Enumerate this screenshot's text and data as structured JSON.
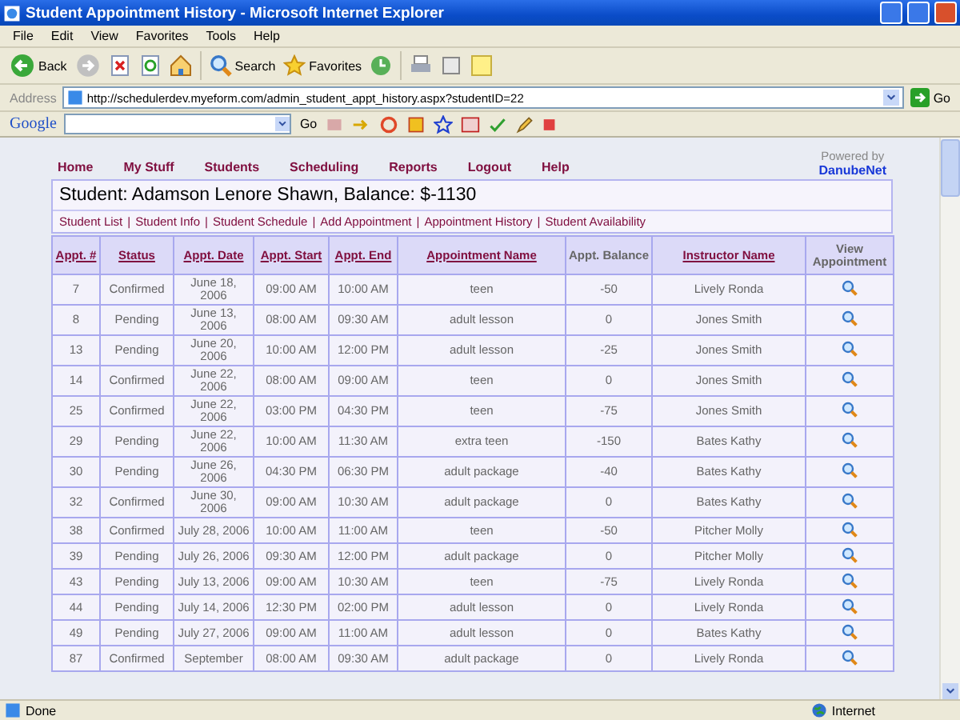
{
  "window": {
    "title": "Student Appointment History - Microsoft Internet Explorer"
  },
  "menu_bar": [
    "File",
    "Edit",
    "View",
    "Favorites",
    "Tools",
    "Help"
  ],
  "toolbar": {
    "back": "Back",
    "search": "Search",
    "favorites": "Favorites"
  },
  "address_bar": {
    "label": "Address",
    "value": "http://schedulerdev.myeform.com/admin_student_appt_history.aspx?studentID=22",
    "go": "Go"
  },
  "google_bar": {
    "logo": "Google",
    "go": "Go"
  },
  "nav": [
    "Home",
    "My Stuff",
    "Students",
    "Scheduling",
    "Reports",
    "Logout",
    "Help"
  ],
  "powered_by": {
    "label": "Powered by",
    "brand": "DanubeNet"
  },
  "heading": "Student: Adamson Lenore Shawn, Balance: $-1130",
  "link_separator": "|",
  "links": [
    "Student List",
    "Student Info",
    "Student Schedule",
    "Add Appointment",
    "Appointment History",
    "Student Availability"
  ],
  "table": {
    "columns": [
      {
        "label": "Appt. #",
        "sortable": true
      },
      {
        "label": "Status",
        "sortable": true
      },
      {
        "label": "Appt. Date",
        "sortable": true
      },
      {
        "label": "Appt. Start",
        "sortable": true
      },
      {
        "label": "Appt. End",
        "sortable": true
      },
      {
        "label": "Appointment Name",
        "sortable": true
      },
      {
        "label": "Appt. Balance",
        "sortable": false
      },
      {
        "label": "Instructor Name",
        "sortable": true
      },
      {
        "label": "View Appointment",
        "sortable": false
      }
    ],
    "rows": [
      [
        "7",
        "Confirmed",
        "June 18,\n2006",
        "09:00 AM",
        "10:00 AM",
        "teen",
        "-50",
        "Lively Ronda"
      ],
      [
        "8",
        "Pending",
        "June 13,\n2006",
        "08:00 AM",
        "09:30 AM",
        "adult lesson",
        "0",
        "Jones Smith"
      ],
      [
        "13",
        "Pending",
        "June 20,\n2006",
        "10:00 AM",
        "12:00 PM",
        "adult lesson",
        "-25",
        "Jones Smith"
      ],
      [
        "14",
        "Confirmed",
        "June 22,\n2006",
        "08:00 AM",
        "09:00 AM",
        "teen",
        "0",
        "Jones Smith"
      ],
      [
        "25",
        "Confirmed",
        "June 22,\n2006",
        "03:00 PM",
        "04:30 PM",
        "teen",
        "-75",
        "Jones Smith"
      ],
      [
        "29",
        "Pending",
        "June 22,\n2006",
        "10:00 AM",
        "11:30 AM",
        "extra teen",
        "-150",
        "Bates Kathy"
      ],
      [
        "30",
        "Pending",
        "June 26,\n2006",
        "04:30 PM",
        "06:30 PM",
        "adult package",
        "-40",
        "Bates Kathy"
      ],
      [
        "32",
        "Confirmed",
        "June 30,\n2006",
        "09:00 AM",
        "10:30 AM",
        "adult package",
        "0",
        "Bates Kathy"
      ],
      [
        "38",
        "Confirmed",
        "July 28, 2006",
        "10:00 AM",
        "11:00 AM",
        "teen",
        "-50",
        "Pitcher Molly"
      ],
      [
        "39",
        "Pending",
        "July 26, 2006",
        "09:30 AM",
        "12:00 PM",
        "adult package",
        "0",
        "Pitcher Molly"
      ],
      [
        "43",
        "Pending",
        "July 13, 2006",
        "09:00 AM",
        "10:30 AM",
        "teen",
        "-75",
        "Lively Ronda"
      ],
      [
        "44",
        "Pending",
        "July 14, 2006",
        "12:30 PM",
        "02:00 PM",
        "adult lesson",
        "0",
        "Lively Ronda"
      ],
      [
        "49",
        "Pending",
        "July 27, 2006",
        "09:00 AM",
        "11:00 AM",
        "adult lesson",
        "0",
        "Bates Kathy"
      ],
      [
        "87",
        "Confirmed",
        "September",
        "08:00 AM",
        "09:30 AM",
        "adult package",
        "0",
        "Lively Ronda"
      ]
    ]
  },
  "status_bar": {
    "text": "Done",
    "zone": "Internet"
  }
}
